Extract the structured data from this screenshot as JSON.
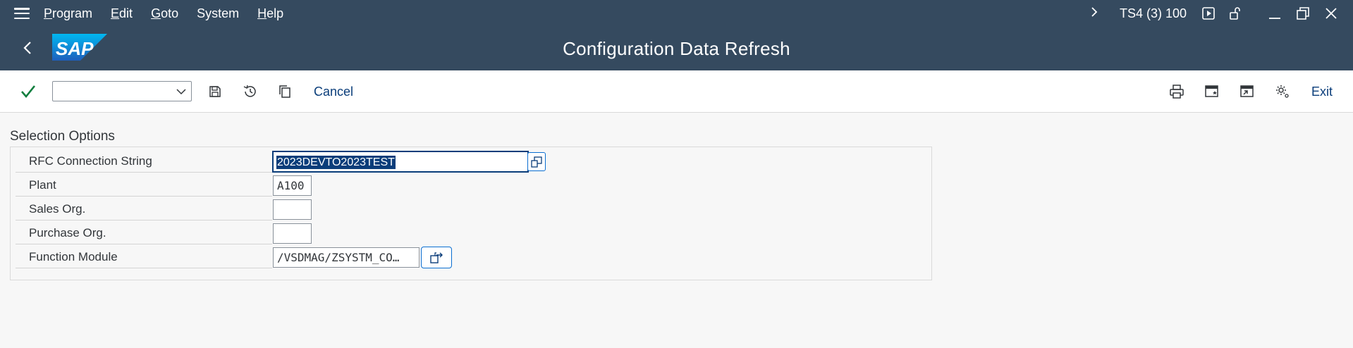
{
  "menu": {
    "items": [
      {
        "u": "P",
        "rest": "rogram"
      },
      {
        "u": "E",
        "rest": "dit"
      },
      {
        "u": "G",
        "rest": "oto"
      },
      {
        "u": "",
        "rest": "System"
      },
      {
        "u": "H",
        "rest": "elp"
      }
    ],
    "system_info": "TS4 (3) 100"
  },
  "title": {
    "logo_text": "SAP",
    "page_title": "Configuration Data Refresh"
  },
  "toolbar": {
    "command_value": "",
    "cancel_label": "Cancel",
    "exit_label": "Exit"
  },
  "selection": {
    "section_title": "Selection Options",
    "fields": [
      {
        "label": "RFC Connection String",
        "value": "2023DEVTO2023TEST"
      },
      {
        "label": "Plant",
        "value": "A100"
      },
      {
        "label": "Sales Org.",
        "value": ""
      },
      {
        "label": "Purchase Org.",
        "value": ""
      },
      {
        "label": "Function Module",
        "value": "/VSDMAG/ZSYSTM_CO…"
      }
    ]
  },
  "colors": {
    "shell": "#354a5f",
    "accent": "#0a3d7a",
    "success": "#107e3e"
  },
  "icons": {
    "menu": "hamburger-icon",
    "back": "back-arrow-icon",
    "ok": "checkmark-icon",
    "save": "save-icon",
    "history": "history-icon",
    "copy": "copy-icon",
    "print": "print-icon",
    "new_window": "new-window-icon",
    "open_window": "open-window-icon",
    "settings": "settings-icon",
    "value_help": "value-help-icon",
    "navigate": "navigate-icon"
  }
}
